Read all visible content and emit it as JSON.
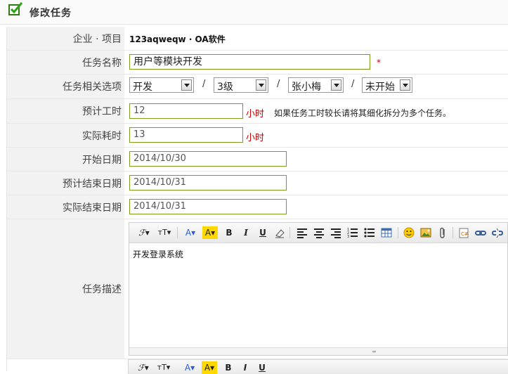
{
  "header": {
    "title": "修改任务"
  },
  "form": {
    "company_project": {
      "label": "企业 · 项目",
      "value": "123aqweqw · OA软件"
    },
    "task_name": {
      "label": "任务名称",
      "value": "用户等模块开发",
      "required_mark": "*"
    },
    "options": {
      "label": "任务相关选项",
      "type": "开发",
      "level": "3级",
      "assignee": "张小梅",
      "status": "未开始",
      "separator": "/"
    },
    "estimated_hours": {
      "label": "预计工时",
      "value": "12",
      "unit": "小时",
      "note": "如果任务工时较长请将其细化拆分为多个任务。"
    },
    "actual_hours": {
      "label": "实际耗时",
      "value": "13",
      "unit": "小时"
    },
    "start_date": {
      "label": "开始日期",
      "value": "2014/10/30"
    },
    "est_end_date": {
      "label": "预计结束日期",
      "value": "2014/10/31"
    },
    "actual_end_date": {
      "label": "实际结束日期",
      "value": "2014/10/31"
    },
    "description": {
      "label": "任务描述",
      "content": "开发登录系统"
    }
  },
  "toolbar": {
    "font_family": "ℱ▾",
    "font_size": "ᴛT▾",
    "font_color": "A▾",
    "highlight": "A▾",
    "bold": "B",
    "italic": "I",
    "underline": "U"
  },
  "colors": {
    "accent_border": "#7a9e1c",
    "unit_red": "#cc0000",
    "label_bg": "#f2f2f2"
  }
}
